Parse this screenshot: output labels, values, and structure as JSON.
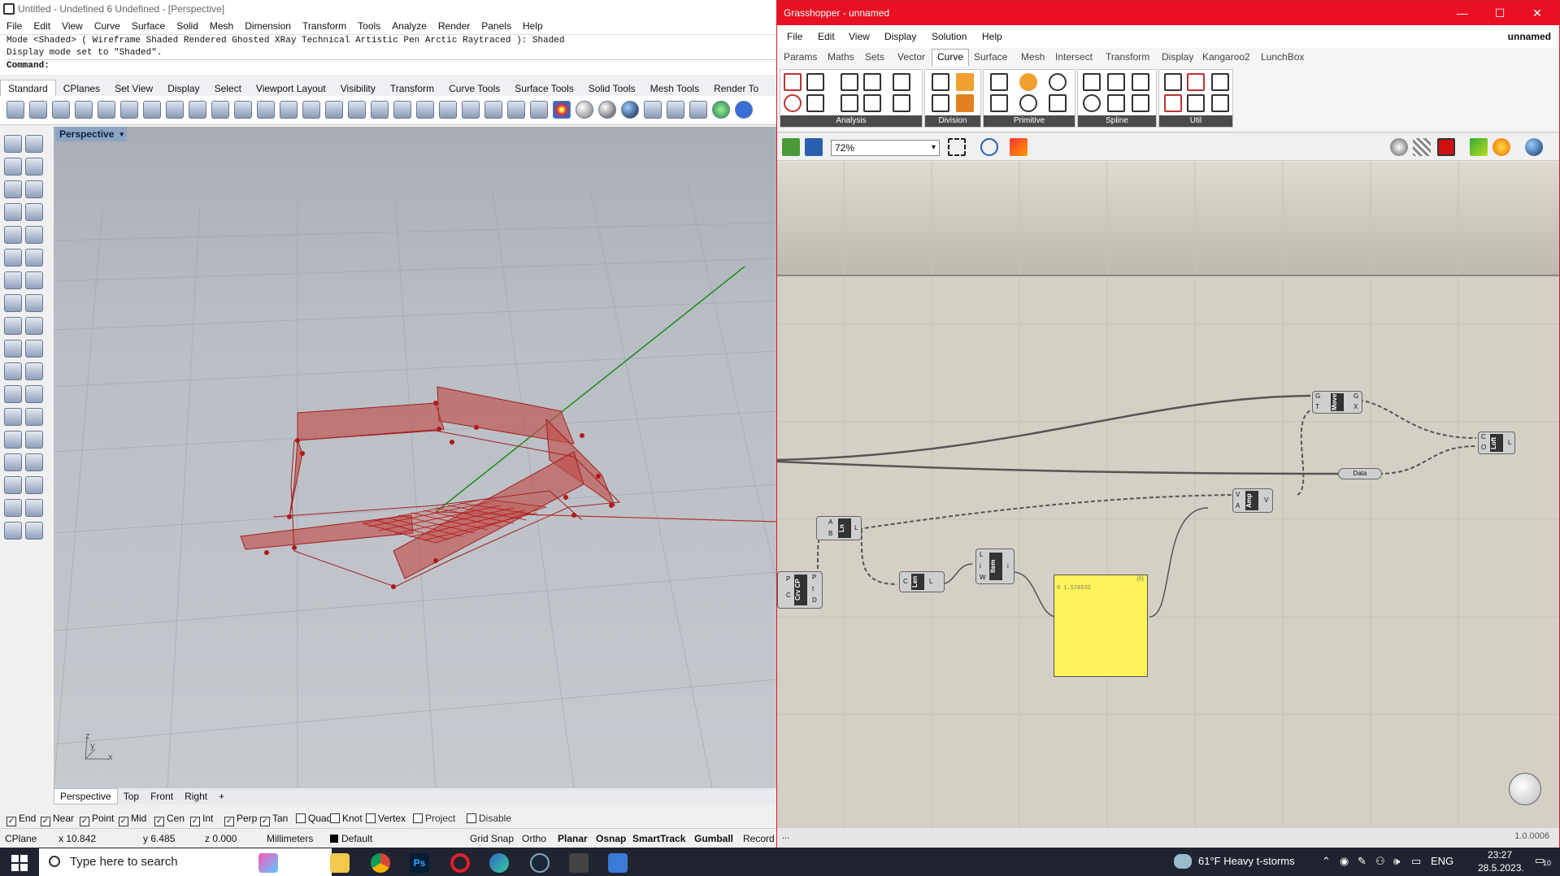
{
  "rhino": {
    "title": "Untitled - Undefined 6 Undefined - [Perspective]",
    "menu": [
      "File",
      "Edit",
      "View",
      "Curve",
      "Surface",
      "Solid",
      "Mesh",
      "Dimension",
      "Transform",
      "Tools",
      "Analyze",
      "Render",
      "Panels",
      "Help"
    ],
    "command_history": [
      "Mode <Shaded> ( Wireframe Shaded Rendered Ghosted XRay Technical Artistic Pen Arctic Raytraced ): Shaded",
      "Display mode set to \"Shaded\"."
    ],
    "command_prompt": "Command:",
    "toolbar_tabs": [
      "Standard",
      "CPlanes",
      "Set View",
      "Display",
      "Select",
      "Viewport Layout",
      "Visibility",
      "Transform",
      "Curve Tools",
      "Surface Tools",
      "Solid Tools",
      "Mesh Tools",
      "Render To"
    ],
    "active_toolbar_tab": "Standard",
    "viewport_label": "Perspective",
    "axis_labels": {
      "z": "z",
      "y": "y",
      "x": "x"
    },
    "viewport_tabs": [
      "Perspective",
      "Top",
      "Front",
      "Right"
    ],
    "viewport_add_icon": "plus-icon",
    "osnaps": [
      {
        "label": "End",
        "checked": true
      },
      {
        "label": "Near",
        "checked": true
      },
      {
        "label": "Point",
        "checked": true
      },
      {
        "label": "Mid",
        "checked": true
      },
      {
        "label": "Cen",
        "checked": true
      },
      {
        "label": "Int",
        "checked": true
      },
      {
        "label": "Perp",
        "checked": true
      },
      {
        "label": "Tan",
        "checked": true
      },
      {
        "label": "Quad",
        "checked": false
      },
      {
        "label": "Knot",
        "checked": false
      },
      {
        "label": "Vertex",
        "checked": false
      },
      {
        "label": "Project",
        "checked": false
      },
      {
        "label": "Disable",
        "checked": false
      }
    ],
    "status": {
      "cplane": "CPlane",
      "x": "x 10.842",
      "y": "y 6.485",
      "z": "z 0.000",
      "units": "Millimeters",
      "layer": "Default",
      "toggles": [
        "Grid Snap",
        "Ortho",
        "Planar",
        "Osnap",
        "SmartTrack",
        "Gumball",
        "Record"
      ]
    }
  },
  "grasshopper": {
    "title": "Grasshopper - unnamed",
    "doc_name": "unnamed",
    "menu": [
      "File",
      "Edit",
      "View",
      "Display",
      "Solution",
      "Help"
    ],
    "tabs": [
      "Params",
      "Maths",
      "Sets",
      "Vector",
      "Curve",
      "Surface",
      "Mesh",
      "Intersect",
      "Transform",
      "Display",
      "Kangaroo2",
      "LunchBox"
    ],
    "active_tab": "Curve",
    "ribbon_groups": [
      "Analysis",
      "Division",
      "Primitive",
      "Spline",
      "Util"
    ],
    "zoom": "72%",
    "panel_text": "0 1.520532",
    "panel_header": "{0}",
    "components": {
      "move": {
        "label": "Move",
        "inputs": [
          "G",
          "T"
        ],
        "outputs": [
          "G",
          "X"
        ]
      },
      "loft": {
        "label": "Loft",
        "inputs": [
          "C",
          "O"
        ],
        "outputs": [
          "L"
        ]
      },
      "data": {
        "label": "Data"
      },
      "amp": {
        "label": "Amp",
        "inputs": [
          "V",
          "A"
        ],
        "outputs": [
          "V"
        ]
      },
      "ln": {
        "label": "Ln",
        "inputs": [
          "A",
          "B"
        ],
        "outputs": [
          "L"
        ]
      },
      "len": {
        "label": "Len",
        "inputs": [
          "C"
        ],
        "outputs": [
          "L"
        ]
      },
      "item": {
        "label": "Item",
        "inputs": [
          "L",
          "i",
          "W"
        ],
        "outputs": [
          "i"
        ]
      },
      "crvcp": {
        "label": "Crv CP",
        "inputs": [
          "P",
          "C"
        ],
        "outputs": [
          "P",
          "t",
          "D"
        ]
      }
    },
    "version": "1.0.0006",
    "bottom_left": "..."
  },
  "taskbar": {
    "search_placeholder": "Type here to search",
    "weather": "61°F  Heavy t-storms",
    "language": "ENG",
    "time": "23:27",
    "date": "28.5.2023.",
    "notifications": "10"
  },
  "colors": {
    "gh_red": "#e81123",
    "surface_red": "#c0504d",
    "panel_yellow": "#fff35a",
    "y_axis_green": "#1d8a1d"
  }
}
